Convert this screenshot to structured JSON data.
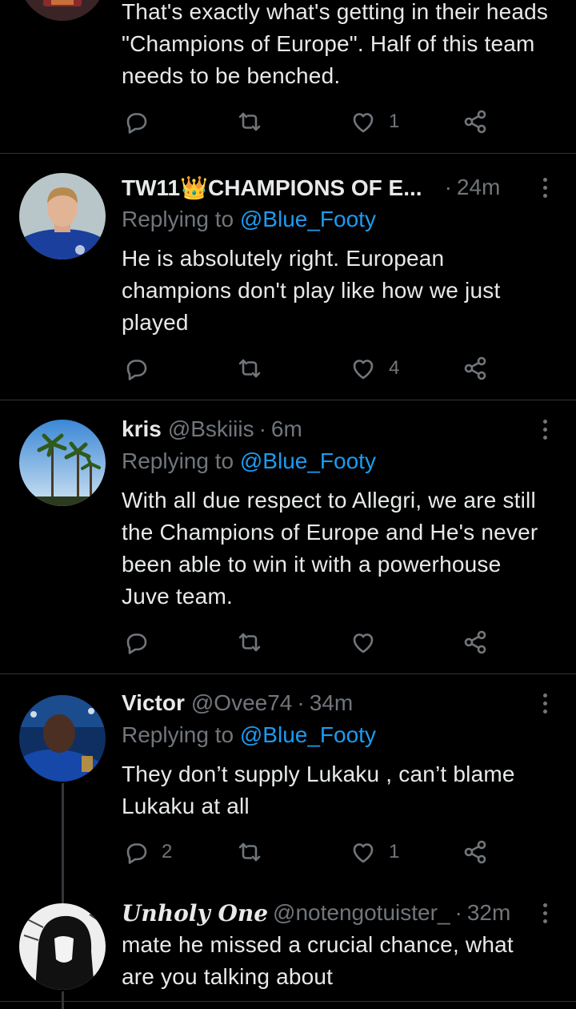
{
  "tweets": [
    {
      "body": "That's exactly what's getting in their heads \"Champions of Europe\". Half of this team needs to be benched.",
      "reply_count": "",
      "like_count": "1"
    },
    {
      "name": "TW11👑CHAMPIONS OF E...",
      "handle": "",
      "time": "24m",
      "replying_label": "Replying to",
      "mention": "@Blue_Footy",
      "body": "He is absolutely right. European champions don't play like how we just played",
      "reply_count": "",
      "like_count": "4"
    },
    {
      "name": "kris",
      "handle": "@Bskiiis",
      "time": "6m",
      "replying_label": "Replying to",
      "mention": "@Blue_Footy",
      "body": "With all due respect to Allegri, we are still the Champions of Europe and He's never been able to win it with a powerhouse Juve team.",
      "reply_count": "",
      "like_count": ""
    },
    {
      "name": "Victor",
      "handle": "@Ovee74",
      "time": "34m",
      "replying_label": "Replying to",
      "mention": "@Blue_Footy",
      "body": "They don’t supply Lukaku , can’t blame Lukaku at all",
      "reply_count": "2",
      "like_count": "1"
    },
    {
      "name": "Unholy One",
      "handle": "@notengotuister_",
      "time": "32m",
      "body": "mate he missed a crucial chance, what are you talking about"
    }
  ],
  "separator": "·",
  "icons": [
    "reply-icon",
    "retweet-icon",
    "like-icon",
    "share-icon",
    "more-icon"
  ],
  "colors": {
    "background": "#000000",
    "text": "#e7e9ea",
    "muted": "#71767b",
    "link": "#1d9bf0",
    "divider": "#2f3336"
  }
}
